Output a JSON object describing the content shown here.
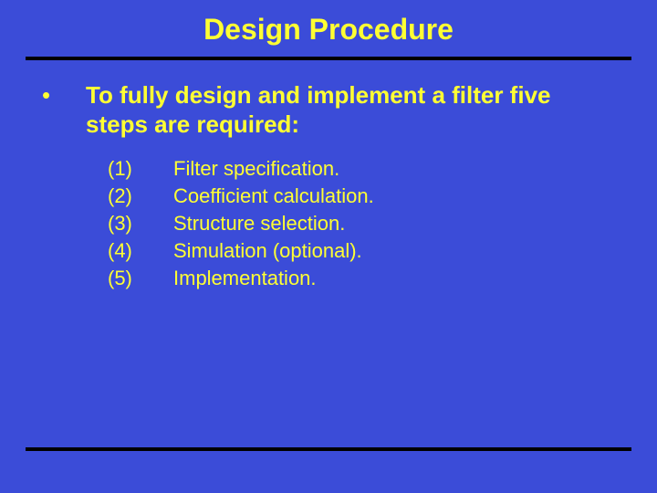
{
  "title": "Design Procedure",
  "bullet_glyph": "•",
  "subtitle": "To fully design and implement a filter five steps are required:",
  "steps": [
    {
      "num": "(1)",
      "text": "Filter specification."
    },
    {
      "num": "(2)",
      "text": "Coefficient calculation."
    },
    {
      "num": "(3)",
      "text": "Structure selection."
    },
    {
      "num": "(4)",
      "text": "Simulation (optional)."
    },
    {
      "num": "(5)",
      "text": "Implementation."
    }
  ]
}
